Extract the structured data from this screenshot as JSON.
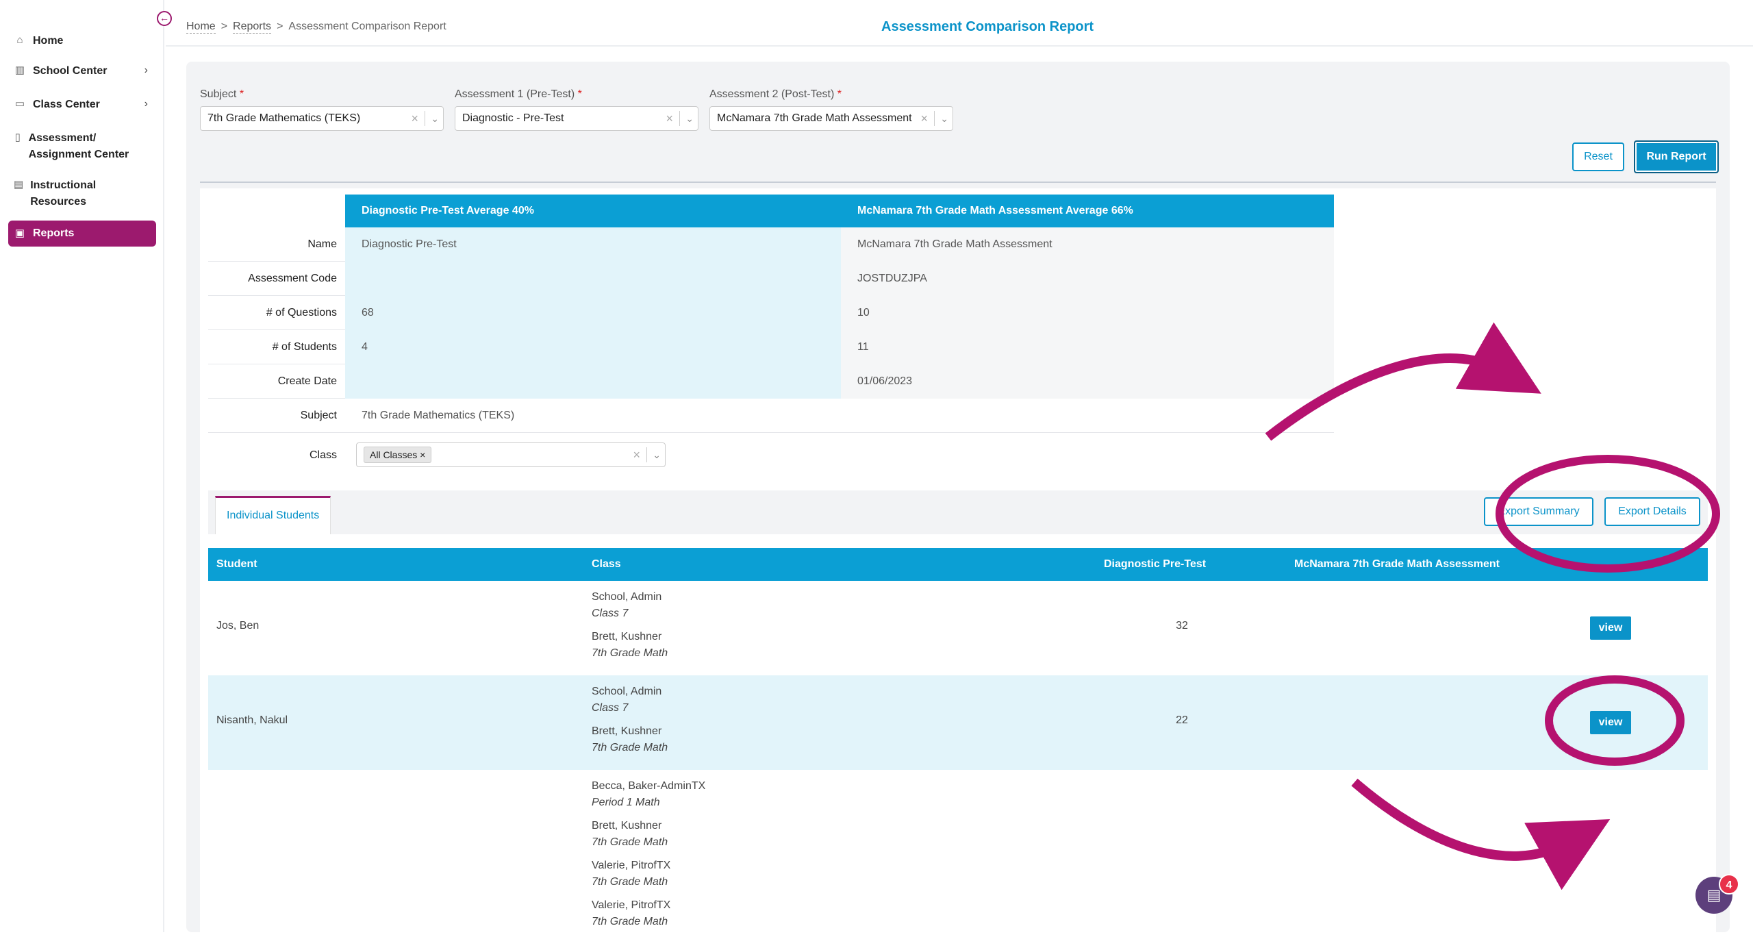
{
  "sidebar": {
    "items": [
      {
        "label": "Home",
        "icon": "home-icon"
      },
      {
        "label": "School Center",
        "icon": "building-icon"
      },
      {
        "label": "Class Center",
        "icon": "monitor-icon"
      },
      {
        "label": "Assessment/ Assignment Center",
        "icon": "book-icon"
      },
      {
        "label": "Instructional Resources",
        "icon": "open-book-icon"
      },
      {
        "label": "Reports",
        "icon": "report-icon"
      }
    ]
  },
  "breadcrumb": {
    "home": "Home",
    "reports": "Reports",
    "current": "Assessment Comparison Report",
    "sep": ">"
  },
  "page_title": "Assessment Comparison Report",
  "filters": {
    "subject": {
      "label": "Subject",
      "value": "7th Grade Mathematics (TEKS)"
    },
    "assessment1": {
      "label": "Assessment 1 (Pre-Test)",
      "value": "Diagnostic - Pre-Test"
    },
    "assessment2": {
      "label": "Assessment 2 (Post-Test)",
      "value": "McNamara 7th Grade Math Assessment"
    },
    "required_mark": "*"
  },
  "buttons": {
    "reset": "Reset",
    "run_report": "Run Report",
    "export_summary": "Export Summary",
    "export_details": "Export Details"
  },
  "comparison": {
    "head1": "Diagnostic Pre-Test Average 40%",
    "head2": "McNamara 7th Grade Math Assessment Average 66%",
    "rows": [
      {
        "label": "Name",
        "a1": "Diagnostic Pre-Test",
        "a2": "McNamara 7th Grade Math Assessment"
      },
      {
        "label": "Assessment Code",
        "a1": "",
        "a2": "JOSTDUZJPA"
      },
      {
        "label": "# of Questions",
        "a1": "68",
        "a2": "10"
      },
      {
        "label": "# of Students",
        "a1": "4",
        "a2": "11"
      },
      {
        "label": "Create Date",
        "a1": "",
        "a2": "01/06/2023"
      }
    ],
    "subject_label": "Subject",
    "subject_value": "7th Grade Mathematics (TEKS)",
    "class_label": "Class",
    "class_tag": "All Classes"
  },
  "tabs": {
    "individual": "Individual Students"
  },
  "students_table": {
    "headers": {
      "student": "Student",
      "class": "Class",
      "pre": "Diagnostic Pre-Test",
      "post": "McNamara 7th Grade Math Assessment"
    },
    "rows": [
      {
        "name": "Jos, Ben",
        "score": "32",
        "view": "view",
        "classes": [
          {
            "teacher": "School, Admin",
            "class": "Class 7"
          },
          {
            "teacher": "Brett, Kushner",
            "class": "7th Grade Math"
          }
        ]
      },
      {
        "name": "Nisanth, Nakul",
        "score": "22",
        "view": "view",
        "classes": [
          {
            "teacher": "School, Admin",
            "class": "Class 7"
          },
          {
            "teacher": "Brett, Kushner",
            "class": "7th Grade Math"
          }
        ]
      },
      {
        "name": "",
        "score": "",
        "view": "",
        "classes": [
          {
            "teacher": "Becca, Baker-AdminTX",
            "class": "Period 1 Math"
          },
          {
            "teacher": "Brett, Kushner",
            "class": "7th Grade Math"
          },
          {
            "teacher": "Valerie, PitrofTX",
            "class": "7th Grade Math"
          },
          {
            "teacher": "Valerie, PitrofTX",
            "class": "7th Grade Math"
          }
        ]
      }
    ]
  },
  "chat": {
    "badge": "4"
  },
  "colors": {
    "accent": "#0b93c9",
    "brand": "#9c1a6e",
    "annotation": "#b5126f"
  }
}
